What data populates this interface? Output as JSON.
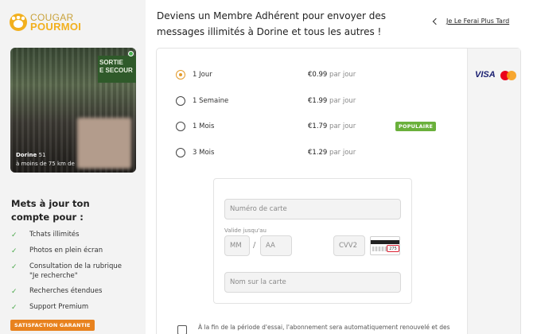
{
  "brand": {
    "line1": "COUGAR",
    "line2": "POURMOI"
  },
  "profile": {
    "name": "Dorine",
    "age": "51",
    "distance": "à moins de 75 km de",
    "sign_text": "SORTIE\nE SECOUR",
    "online_color": "#48b24f"
  },
  "sidebar": {
    "upgrade_title": "Mets à jour ton compte pour :",
    "benefits": [
      {
        "label": "Tchats illimités",
        "icon": "check-icon"
      },
      {
        "label": "Photos en plein écran",
        "icon": "check-icon"
      },
      {
        "label": "Consultation de la rubrique \"Je recherche\"",
        "icon": "check-icon"
      },
      {
        "label": "Recherches étendues",
        "icon": "check-icon"
      },
      {
        "label": "Support Premium",
        "icon": "check-icon"
      }
    ],
    "guarantee": "SATISFACTION GARANTIE"
  },
  "header": {
    "headline": "Deviens un Membre Adhérent pour envoyer des messages illimités à Dorine et tous les autres !",
    "later_link": "Je Le Ferai Plus Tard"
  },
  "payment": {
    "card_brands": [
      "VISA",
      "mastercard"
    ],
    "plans": [
      {
        "name": "1 Jour",
        "price": "€0.99",
        "per": "par jour",
        "selected": true,
        "badge": ""
      },
      {
        "name": "1 Semaine",
        "price": "€1.99",
        "per": "par jour",
        "selected": false,
        "badge": ""
      },
      {
        "name": "1 Mois",
        "price": "€1.79",
        "per": "par jour",
        "selected": false,
        "badge": "POPULAIRE"
      },
      {
        "name": "3 Mois",
        "price": "€1.29",
        "per": "par jour",
        "selected": false,
        "badge": ""
      }
    ],
    "form": {
      "card_number_placeholder": "Numéro de carte",
      "valid_until_label": "Valide jusqu'au",
      "month_placeholder": "MM",
      "separator": "/",
      "year_placeholder": "AA",
      "cvv_placeholder": "CVV2",
      "cvv_example": "275",
      "name_placeholder": "Nom sur la carte"
    },
    "terms": "À la fin de la période d'essai, l'abonnement sera automatiquement renouvelé et des"
  },
  "colors": {
    "accent": "#f2b01e",
    "selected_radio": "#e39b2c",
    "badge": "#6ab03b",
    "guarantee": "#e8821e"
  }
}
